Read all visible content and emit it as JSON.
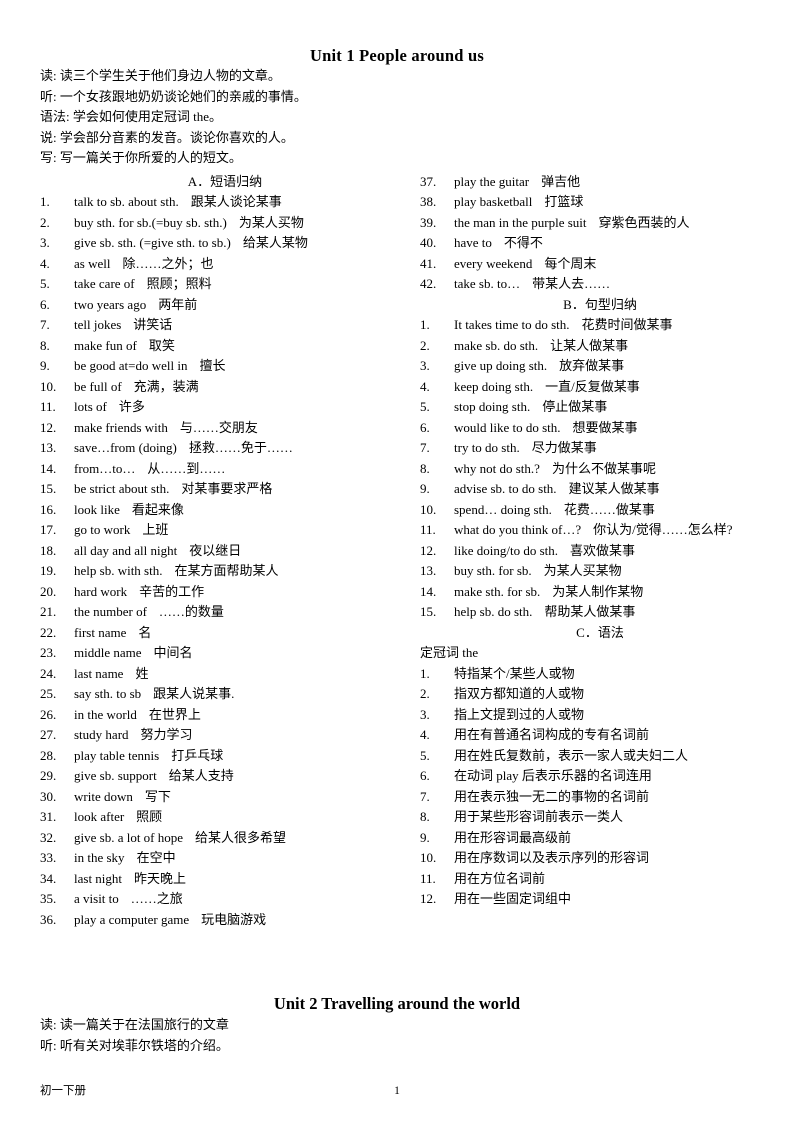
{
  "document": {
    "footer": {
      "left_text": "初一下册",
      "page_number": "1"
    }
  },
  "unit1": {
    "title": "Unit 1 People around us",
    "intro": [
      {
        "label": "读:",
        "text": "读三个学生关于他们身边人物的文章。"
      },
      {
        "label": "听:",
        "text": "一个女孩跟地奶奶谈论她们的亲戚的事情。"
      },
      {
        "label": "语法:",
        "text": "学会如何使用定冠词 the。"
      },
      {
        "label": "说:",
        "text": "学会部分音素的发音。谈论你喜欢的人。"
      },
      {
        "label": "写:",
        "text": "写一篇关于你所爱的人的短文。"
      }
    ],
    "section_a": {
      "heading": "A．短语归纳",
      "items": [
        {
          "n": "1.",
          "en": "talk to sb. about sth.",
          "cn": "跟某人谈论某事"
        },
        {
          "n": "2.",
          "en": "buy sth. for sb.(=buy sb. sth.)",
          "cn": "为某人买物"
        },
        {
          "n": "3.",
          "en": "give sb. sth. (=give sth. to sb.)",
          "cn": "给某人某物"
        },
        {
          "n": "4.",
          "en": "as well",
          "cn": "除……之外；也"
        },
        {
          "n": "5.",
          "en": "take care of",
          "cn": "照顾；照料"
        },
        {
          "n": "6.",
          "en": "two years ago",
          "cn": "两年前"
        },
        {
          "n": "7.",
          "en": "tell jokes",
          "cn": "讲笑话"
        },
        {
          "n": "8.",
          "en": "make fun of",
          "cn": "取笑"
        },
        {
          "n": "9.",
          "en": "be good at=do well in",
          "cn": "擅长"
        },
        {
          "n": "10.",
          "en": "be full of",
          "cn": "充满，装满"
        },
        {
          "n": "11.",
          "en": "lots of",
          "cn": "许多"
        },
        {
          "n": "12.",
          "en": "make friends with",
          "cn": "与……交朋友"
        },
        {
          "n": "13.",
          "en": "save…from (doing)",
          "cn": "拯救……免于……"
        },
        {
          "n": "14.",
          "en": "from…to…",
          "cn": "从……到……"
        },
        {
          "n": "15.",
          "en": "be strict about sth.",
          "cn": "对某事要求严格"
        },
        {
          "n": "16.",
          "en": "look like",
          "cn": "看起来像"
        },
        {
          "n": "17.",
          "en": "go to work",
          "cn": "上班"
        },
        {
          "n": "18.",
          "en": "all day and all night",
          "cn": "夜以继日"
        },
        {
          "n": "19.",
          "en": "help sb. with sth.",
          "cn": "在某方面帮助某人"
        },
        {
          "n": "20.",
          "en": "hard work",
          "cn": "辛苦的工作"
        },
        {
          "n": "21.",
          "en": "the number of",
          "cn": "……的数量"
        },
        {
          "n": "22.",
          "en": "first name",
          "cn": "名"
        },
        {
          "n": "23.",
          "en": "middle name",
          "cn": "中间名"
        },
        {
          "n": "24.",
          "en": "last name",
          "cn": "姓"
        },
        {
          "n": "25.",
          "en": "say sth. to sb",
          "cn": "跟某人说某事."
        },
        {
          "n": "26.",
          "en": "in the world",
          "cn": "在世界上"
        },
        {
          "n": "27.",
          "en": "study hard",
          "cn": "努力学习"
        },
        {
          "n": "28.",
          "en": "play table tennis",
          "cn": "打乒乓球"
        },
        {
          "n": "29.",
          "en": "give sb. support",
          "cn": "给某人支持"
        },
        {
          "n": "30.",
          "en": "write down",
          "cn": "写下"
        },
        {
          "n": "31.",
          "en": "look after",
          "cn": "照顾"
        },
        {
          "n": "32.",
          "en": "give sb. a lot of hope",
          "cn": "给某人很多希望"
        },
        {
          "n": "33.",
          "en": "in the sky",
          "cn": "在空中"
        },
        {
          "n": "34.",
          "en": "last night",
          "cn": "昨天晚上"
        },
        {
          "n": "35.",
          "en": "a visit to",
          "cn": "……之旅"
        },
        {
          "n": "36.",
          "en": "play a computer game",
          "cn": "玩电脑游戏"
        },
        {
          "n": "37.",
          "en": "play the guitar",
          "cn": "弹吉他"
        },
        {
          "n": "38.",
          "en": "play basketball",
          "cn": "打篮球"
        },
        {
          "n": "39.",
          "en": "the man in the purple suit",
          "cn": "穿紫色西装的人"
        },
        {
          "n": "40.",
          "en": "have to",
          "cn": "不得不"
        },
        {
          "n": "41.",
          "en": "every weekend",
          "cn": "每个周末"
        },
        {
          "n": "42.",
          "en": "take sb. to…",
          "cn": "带某人去……"
        }
      ]
    },
    "section_b": {
      "heading": "B．句型归纳",
      "items": [
        {
          "n": "1.",
          "en": "It takes time to do sth.",
          "cn": "花费时间做某事"
        },
        {
          "n": "2.",
          "en": "make sb. do sth.",
          "cn": "让某人做某事"
        },
        {
          "n": "3.",
          "en": "give up doing sth.",
          "cn": "放弃做某事"
        },
        {
          "n": "4.",
          "en": "keep doing sth.",
          "cn": "一直/反复做某事"
        },
        {
          "n": "5.",
          "en": "stop doing sth.",
          "cn": "停止做某事"
        },
        {
          "n": "6.",
          "en": "would like to do sth.",
          "cn": "想要做某事"
        },
        {
          "n": "7.",
          "en": "try to do sth.",
          "cn": "尽力做某事"
        },
        {
          "n": "8.",
          "en": "why not do sth.?",
          "cn": "为什么不做某事呢"
        },
        {
          "n": "9.",
          "en": "advise sb. to do sth.",
          "cn": "建议某人做某事"
        },
        {
          "n": "10.",
          "en": "spend… doing sth.",
          "cn": "花费……做某事"
        },
        {
          "n": "11.",
          "en": "what do you think of…?",
          "cn": "你认为/觉得……怎么样?"
        },
        {
          "n": "12.",
          "en": "like doing/to do sth.",
          "cn": "喜欢做某事"
        },
        {
          "n": "13.",
          "en": "buy sth. for sb.",
          "cn": "为某人买某物"
        },
        {
          "n": "14.",
          "en": "make sth. for sb.",
          "cn": "为某人制作某物"
        },
        {
          "n": "15.",
          "en": "help sb. do sth.",
          "cn": "帮助某人做某事"
        }
      ]
    },
    "section_c": {
      "heading": "C．语法",
      "subhead": "定冠词 the",
      "items": [
        {
          "n": "1.",
          "cn": "特指某个/某些人或物"
        },
        {
          "n": "2.",
          "cn": "指双方都知道的人或物"
        },
        {
          "n": "3.",
          "cn": "指上文提到过的人或物"
        },
        {
          "n": "4.",
          "cn": "用在有普通名词构成的专有名词前"
        },
        {
          "n": "5.",
          "cn": "用在姓氏复数前，表示一家人或夫妇二人"
        },
        {
          "n": "6.",
          "cn": "在动词 play 后表示乐器的名词连用"
        },
        {
          "n": "7.",
          "cn": "用在表示独一无二的事物的名词前"
        },
        {
          "n": "8.",
          "cn": "用于某些形容词前表示一类人"
        },
        {
          "n": "9.",
          "cn": "用在形容词最高级前"
        },
        {
          "n": "10.",
          "cn": "用在序数词以及表示序列的形容词"
        },
        {
          "n": "11.",
          "cn": "用在方位名词前"
        },
        {
          "n": "12.",
          "cn": "用在一些固定词组中"
        }
      ]
    }
  },
  "unit2": {
    "title": "Unit 2 Travelling around the world",
    "intro": [
      {
        "label": "读:",
        "text": "读一篇关于在法国旅行的文章"
      },
      {
        "label": "听:",
        "text": "听有关对埃菲尔铁塔的介绍。"
      }
    ]
  }
}
